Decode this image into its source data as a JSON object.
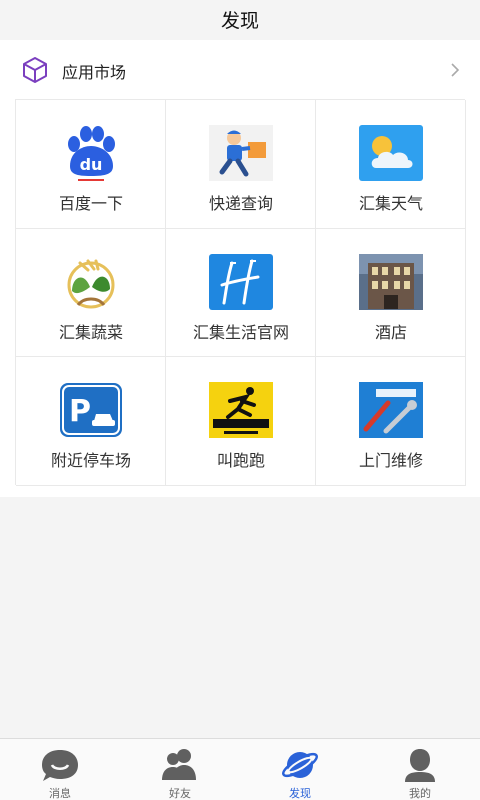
{
  "header": {
    "title": "发现"
  },
  "market": {
    "label": "应用市场"
  },
  "apps": [
    {
      "name": "百度一下",
      "icon": "baidu-icon"
    },
    {
      "name": "快递查询",
      "icon": "courier-icon"
    },
    {
      "name": "汇集天气",
      "icon": "weather-icon"
    },
    {
      "name": "汇集蔬菜",
      "icon": "vegetable-icon"
    },
    {
      "name": "汇集生活官网",
      "icon": "huiji-logo-icon"
    },
    {
      "name": "酒店",
      "icon": "hotel-icon"
    },
    {
      "name": "附近停车场",
      "icon": "parking-icon"
    },
    {
      "name": "叫跑跑",
      "icon": "running-icon"
    },
    {
      "name": "上门维修",
      "icon": "repair-icon"
    }
  ],
  "tabs": [
    {
      "label": "消息",
      "icon": "chat-icon"
    },
    {
      "label": "好友",
      "icon": "friends-icon"
    },
    {
      "label": "发现",
      "icon": "planet-icon"
    },
    {
      "label": "我的",
      "icon": "profile-icon"
    }
  ],
  "colors": {
    "accent": "#2a62d8",
    "market_icon": "#7b3fbf",
    "tab_inactive": "#666666"
  }
}
